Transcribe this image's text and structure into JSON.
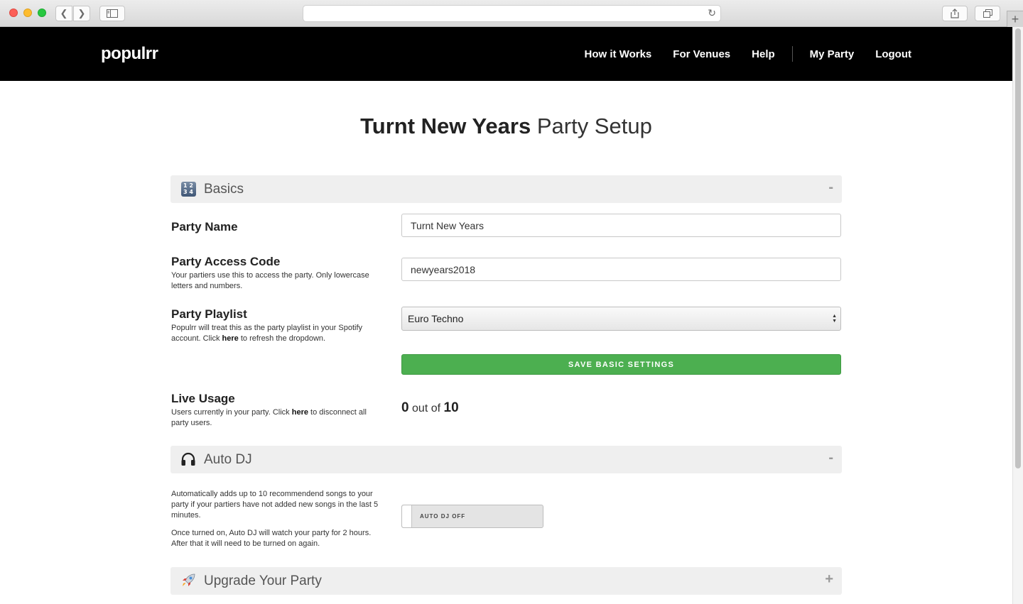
{
  "browser": {
    "url": ""
  },
  "nav": {
    "logo": "populrr",
    "links": [
      "How it Works",
      "For Venues",
      "Help",
      "My Party",
      "Logout"
    ]
  },
  "page": {
    "title_bold": "Turnt New Years",
    "title_rest": "Party Setup"
  },
  "basics": {
    "title": "Basics",
    "icon": "numbers-icon",
    "icon_digits": "1 2 3 4",
    "toggle": "-",
    "party_name": {
      "label": "Party Name",
      "value": "Turnt New Years"
    },
    "access_code": {
      "label": "Party Access Code",
      "help": "Your partiers use this to access the party. Only lowercase letters and numbers.",
      "value": "newyears2018"
    },
    "playlist": {
      "label": "Party Playlist",
      "help_before": "Populrr will treat this as the party playlist in your Spotify account. Click ",
      "help_link": "here",
      "help_after": " to refresh the dropdown.",
      "selected": "Euro Techno"
    },
    "save_label": "SAVE BASIC SETTINGS",
    "live_usage": {
      "label": "Live Usage",
      "help_before": "Users currently in your party. Click ",
      "help_link": "here",
      "help_after": " to disconnect all party users.",
      "current": "0",
      "middle": "out of",
      "max": "10"
    }
  },
  "autodj": {
    "title": "Auto DJ",
    "icon": "headphones-icon",
    "toggle": "-",
    "desc1": "Automatically adds up to 10 recommendend songs to your party if your partiers have not added new songs in the last 5 minutes.",
    "desc2": "Once turned on, Auto DJ will watch your party for 2 hours. After that it will need to be turned on again.",
    "switch_label": "AUTO DJ OFF"
  },
  "upgrade": {
    "title": "Upgrade Your Party",
    "icon": "rocket-icon",
    "toggle": "+"
  }
}
